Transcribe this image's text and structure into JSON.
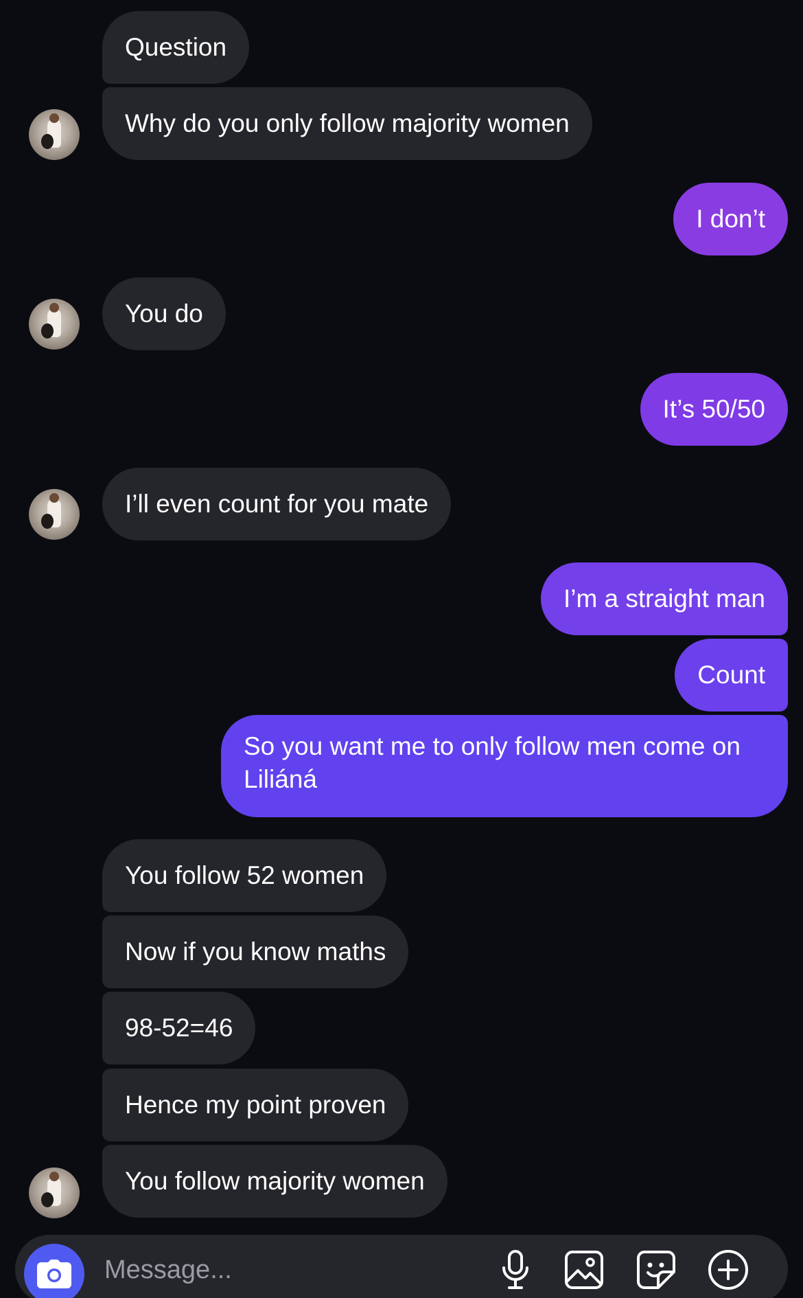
{
  "thread": {
    "messages": [
      {
        "sender": "other",
        "text": "Question"
      },
      {
        "sender": "other",
        "text": "Why do you only follow majority women"
      },
      {
        "sender": "me",
        "text": "I don’t"
      },
      {
        "sender": "other",
        "text": "You do"
      },
      {
        "sender": "me",
        "text": "It’s 50/50"
      },
      {
        "sender": "other",
        "text": "I’ll even count for you mate"
      },
      {
        "sender": "me",
        "text": "I’m a straight man"
      },
      {
        "sender": "me",
        "text": "Count"
      },
      {
        "sender": "me",
        "text": "So you want me to only follow men come on Liliáná"
      },
      {
        "sender": "other",
        "text": "You follow 52 women"
      },
      {
        "sender": "other",
        "text": "Now if you know maths"
      },
      {
        "sender": "other",
        "text": "98-52=46"
      },
      {
        "sender": "other",
        "text": "Hence my point proven"
      },
      {
        "sender": "other",
        "text": "You follow majority women"
      }
    ]
  },
  "composer": {
    "placeholder": "Message..."
  },
  "colors": {
    "background": "#0b0c12",
    "incoming_bubble": "#25262b",
    "outgoing_gradient_top": "#8b3be0",
    "outgoing_gradient_bottom": "#5c3ff0",
    "camera_button": "#4f5bf0"
  },
  "icons": {
    "camera": "camera-icon",
    "microphone": "microphone-icon",
    "gallery": "gallery-icon",
    "sticker": "sticker-icon",
    "more": "plus-circle-icon"
  }
}
